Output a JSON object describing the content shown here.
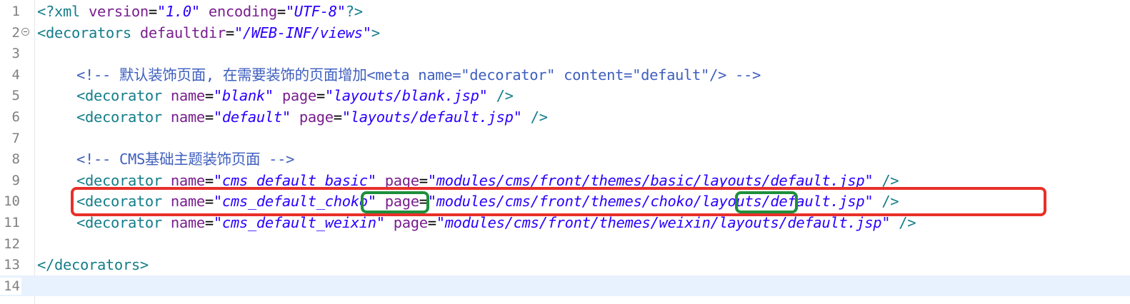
{
  "editor": {
    "lines": [
      {
        "num": "1",
        "parts": [
          [
            "tag",
            "<?xml "
          ],
          [
            "attr",
            "version"
          ],
          [
            "eq",
            "="
          ],
          [
            "val",
            "\"1.0\""
          ],
          [
            "eq",
            " "
          ],
          [
            "attr",
            "encoding"
          ],
          [
            "eq",
            "="
          ],
          [
            "val",
            "\"UTF-8\""
          ],
          [
            "tag",
            "?>"
          ]
        ]
      },
      {
        "num": "2",
        "fold": true,
        "parts": [
          [
            "tag",
            "<decorators "
          ],
          [
            "attr",
            "defaultdir"
          ],
          [
            "eq",
            "="
          ],
          [
            "val",
            "\"/WEB-INF/views\""
          ],
          [
            "tag",
            ">"
          ]
        ]
      },
      {
        "num": "3",
        "parts": []
      },
      {
        "num": "4",
        "indent": true,
        "parts": [
          [
            "cmt",
            "<!-- 默认装饰页面, 在需要装饰的页面增加<meta name=\"decorator\" content=\"default\"/> -->"
          ]
        ]
      },
      {
        "num": "5",
        "indent": true,
        "parts": [
          [
            "tag",
            "<decorator "
          ],
          [
            "attr",
            "name"
          ],
          [
            "eq",
            "="
          ],
          [
            "val",
            "\"blank\""
          ],
          [
            "eq",
            " "
          ],
          [
            "attr",
            "page"
          ],
          [
            "eq",
            "="
          ],
          [
            "val",
            "\"layouts/blank.jsp\""
          ],
          [
            "eq",
            " "
          ],
          [
            "tag",
            "/>"
          ]
        ]
      },
      {
        "num": "6",
        "indent": true,
        "parts": [
          [
            "tag",
            "<decorator "
          ],
          [
            "attr",
            "name"
          ],
          [
            "eq",
            "="
          ],
          [
            "val",
            "\"default\""
          ],
          [
            "eq",
            " "
          ],
          [
            "attr",
            "page"
          ],
          [
            "eq",
            "="
          ],
          [
            "val",
            "\"layouts/default.jsp\""
          ],
          [
            "eq",
            " "
          ],
          [
            "tag",
            "/>"
          ]
        ]
      },
      {
        "num": "7",
        "parts": []
      },
      {
        "num": "8",
        "indent": true,
        "parts": [
          [
            "cmt",
            "<!-- CMS基础主题装饰页面 -->"
          ]
        ]
      },
      {
        "num": "9",
        "indent": true,
        "parts": [
          [
            "tag",
            "<decorator "
          ],
          [
            "attr",
            "name"
          ],
          [
            "eq",
            "="
          ],
          [
            "val",
            "\"cms_default_basic\""
          ],
          [
            "eq",
            " "
          ],
          [
            "attr",
            "page"
          ],
          [
            "eq",
            "="
          ],
          [
            "val",
            "\"modules/cms/front/themes/basic/layouts/default.jsp\""
          ],
          [
            "eq",
            " "
          ],
          [
            "tag",
            "/>"
          ]
        ]
      },
      {
        "num": "10",
        "indent": true,
        "parts": [
          [
            "tag",
            "<decorator "
          ],
          [
            "attr",
            "name"
          ],
          [
            "eq",
            "="
          ],
          [
            "val",
            "\"cms_default_choko\""
          ],
          [
            "eq",
            " "
          ],
          [
            "attr",
            "page"
          ],
          [
            "eq",
            "="
          ],
          [
            "val",
            "\"modules/cms/front/themes/choko/layouts/default.jsp\""
          ],
          [
            "eq",
            " "
          ],
          [
            "tag",
            "/>"
          ]
        ]
      },
      {
        "num": "11",
        "indent": true,
        "parts": [
          [
            "tag",
            "<decorator "
          ],
          [
            "attr",
            "name"
          ],
          [
            "eq",
            "="
          ],
          [
            "val",
            "\"cms_default_weixin\""
          ],
          [
            "eq",
            " "
          ],
          [
            "attr",
            "page"
          ],
          [
            "eq",
            "="
          ],
          [
            "val",
            "\"modules/cms/front/themes/weixin/layouts/default.jsp\""
          ],
          [
            "eq",
            " "
          ],
          [
            "tag",
            "/>"
          ]
        ]
      },
      {
        "num": "12",
        "parts": []
      },
      {
        "num": "13",
        "parts": [
          [
            "tag",
            "</decorators>"
          ]
        ]
      },
      {
        "num": "14",
        "current": true,
        "parts": []
      }
    ]
  },
  "annotations": {
    "red_color": "#e8302a",
    "green_color": "#1e8f3c"
  }
}
